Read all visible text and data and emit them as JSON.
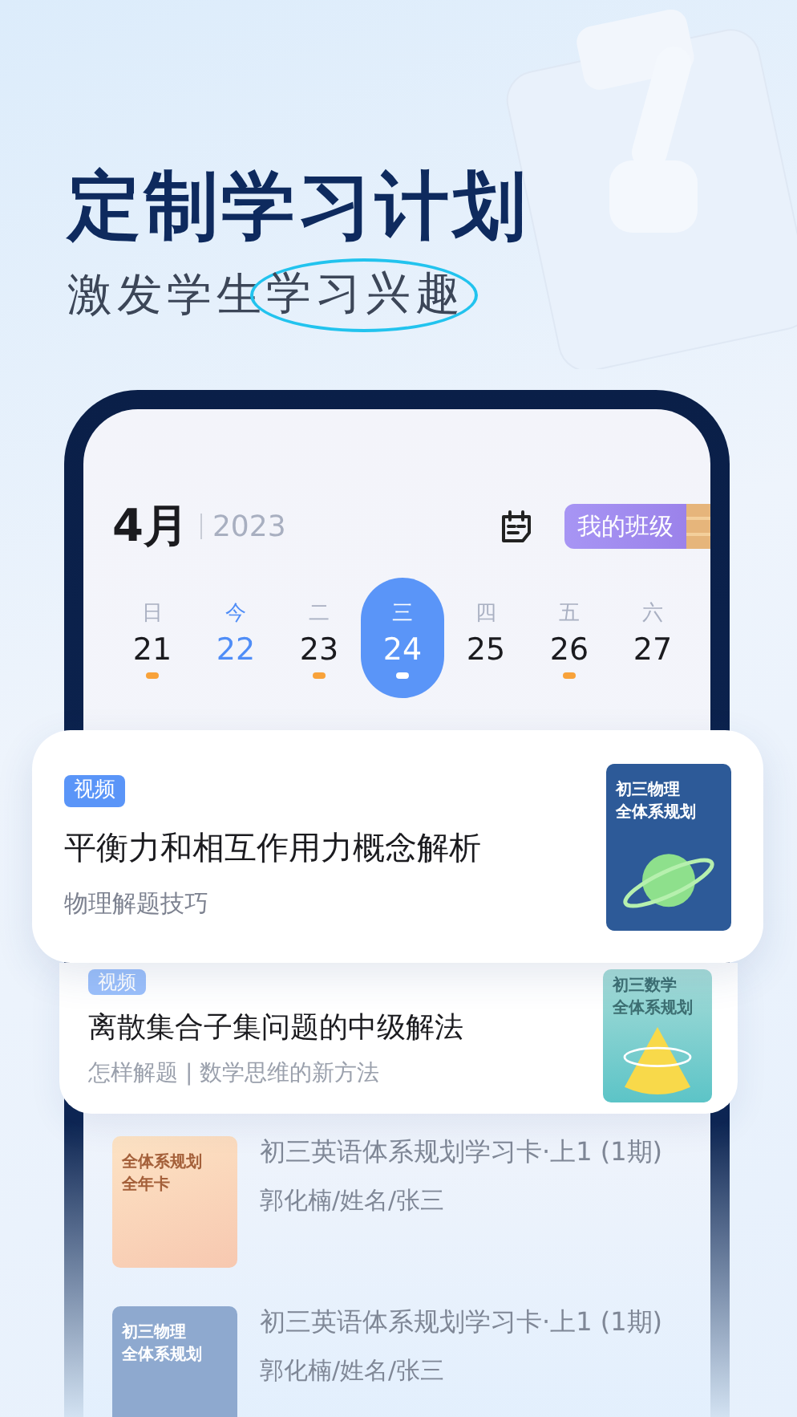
{
  "headline": "定制学习计划",
  "subtitle": {
    "lead": "激发学生",
    "circled": "学习兴趣"
  },
  "calendar": {
    "month": "4月",
    "year": "2023",
    "class_button": "我的班级",
    "days": [
      {
        "weekday": "日",
        "date": "21",
        "today": false,
        "selected": false,
        "marked": true
      },
      {
        "weekday": "今",
        "date": "22",
        "today": true,
        "selected": false,
        "marked": false
      },
      {
        "weekday": "二",
        "date": "23",
        "today": false,
        "selected": false,
        "marked": true
      },
      {
        "weekday": "三",
        "date": "24",
        "today": false,
        "selected": true,
        "marked": true
      },
      {
        "weekday": "四",
        "date": "25",
        "today": false,
        "selected": false,
        "marked": false
      },
      {
        "weekday": "五",
        "date": "26",
        "today": false,
        "selected": false,
        "marked": true
      },
      {
        "weekday": "六",
        "date": "27",
        "today": false,
        "selected": false,
        "marked": false
      }
    ]
  },
  "featured_course": {
    "tag": "视频",
    "title": "平衡力和相互作用力概念解析",
    "subtitle": "物理解题技巧",
    "cover": {
      "kind": "planet",
      "line1": "初三物理",
      "line2": "全体系规划"
    }
  },
  "next_course": {
    "tag": "视频",
    "title": "离散集合子集问题的中级解法",
    "subtitle": "怎样解题 | 数学思维的新方法",
    "cover": {
      "kind": "cone",
      "line1": "初三数学",
      "line2": "全体系规划"
    }
  },
  "faded_courses": [
    {
      "title": "初三英语体系规划学习卡·上1 (1期)",
      "subtitle": "郭化楠/姓名/张三",
      "cover": {
        "kind": "year-card",
        "line1": "全体系规划",
        "line2": "全年卡"
      }
    },
    {
      "title": "初三英语体系规划学习卡·上1 (1期)",
      "subtitle": "郭化楠/姓名/张三",
      "cover": {
        "kind": "planet",
        "line1": "初三物理",
        "line2": "全体系规划"
      }
    }
  ]
}
